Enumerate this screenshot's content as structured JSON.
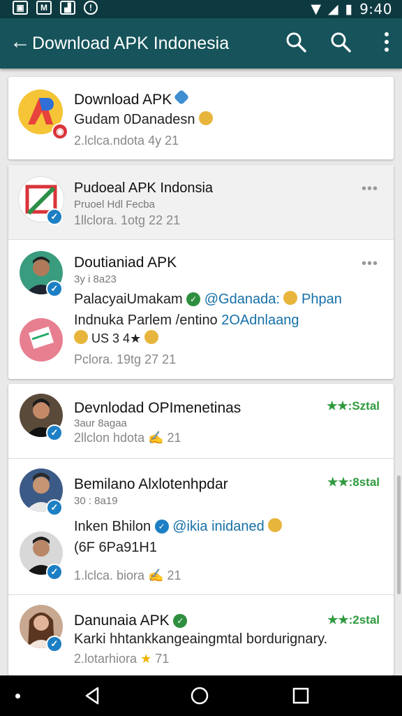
{
  "status_bar": {
    "icons": [
      "gallery-icon",
      "messaging-icon",
      "chart-icon",
      "notification-icon"
    ],
    "time": "9:40"
  },
  "app_bar": {
    "back_glyph": "←",
    "title": "Download APK Indonesia",
    "actions": [
      "search-icon",
      "search-icon",
      "more-vert-icon"
    ]
  },
  "colors": {
    "status_bar": "#0d3a40",
    "app_bar": "#16535a",
    "accent_blue": "#1d7fc4",
    "rating_green": "#2f9a3e"
  },
  "cards": [
    {
      "rows": [
        {
          "name": "Download APK",
          "subtitle": "Gudam 0Danadesn",
          "meta": "2.lclca.ndota 4y 21"
        }
      ]
    },
    {
      "rows": [
        {
          "name": "Pudoeal APK  Indonsia",
          "subtitle": "Pruoel Hdl Fecba",
          "meta": "1llclora. 1otg 22 21",
          "more": "•••"
        },
        {
          "name": "Doutianiad APK",
          "subtitle": "3y i 8a23",
          "message_1_a": "PalacyaiUmakam",
          "message_1_b": "@Gdanada:",
          "message_1_c": "Phpan",
          "message_2_a": "Indnuka Parlem /entino ",
          "message_2_b": "2OAdnlaang",
          "reaction": "US 3 4★",
          "meta": "Pclora. 19tg 27 21",
          "more": "•••"
        }
      ]
    },
    {
      "rows": [
        {
          "name": "Devnlodad OPImenetinas",
          "subtitle": "3aur 8agaa",
          "meta": "2llclon hdota",
          "meta_tail": "21",
          "rating": "★★:Sztal"
        },
        {
          "name": "Bemilano Alxlotenhpdar",
          "subtitle": "30 : 8a19",
          "message_1_a": "Inken Bhilon",
          "message_1_b": "@ikia inidaned",
          "message_2": "(6F 6Pa91H1",
          "meta": "1.lclca. biora",
          "meta_tail": "21",
          "rating": "★★:8stal"
        },
        {
          "name": "Danunaia APK",
          "message": "Karki hhtankkangeaingmtal bordurignary.",
          "meta": "2.lotarhiora",
          "meta_tail": "71",
          "rating": "★★:2stal"
        }
      ]
    }
  ],
  "nav_bar": [
    "back-icon",
    "home-icon",
    "recents-icon"
  ]
}
